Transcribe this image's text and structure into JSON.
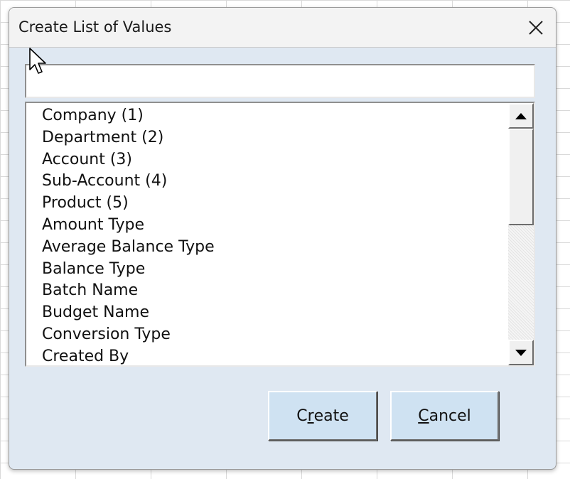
{
  "dialog": {
    "title": "Create List of Values",
    "close_icon": "close-icon"
  },
  "search": {
    "value": "",
    "placeholder": ""
  },
  "list": {
    "items": [
      "Company (1)",
      "Department (2)",
      "Account (3)",
      "Sub-Account (4)",
      "Product (5)",
      "Amount Type",
      "Average Balance Type",
      "Balance Type",
      "Batch Name",
      "Budget Name",
      "Conversion Type",
      "Created By"
    ],
    "scroll_position": 0
  },
  "buttons": {
    "create": {
      "pre": "C",
      "accel": "r",
      "post": "eate"
    },
    "cancel": {
      "pre": "",
      "accel": "C",
      "post": "ancel"
    }
  },
  "colors": {
    "dialog_background": "#dfe8f2",
    "button_background": "#cfe2f2",
    "titlebar_background": "#f3f3f3"
  }
}
